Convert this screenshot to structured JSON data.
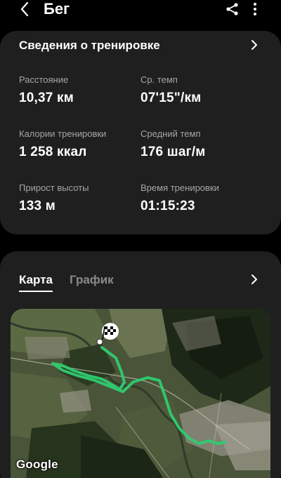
{
  "header": {
    "title": "Бег",
    "icons": {
      "back": "chevron-left-icon",
      "share": "share-icon",
      "more": "more-vertical-icon"
    }
  },
  "details": {
    "title": "Сведения о тренировке",
    "metrics": {
      "distance": {
        "label": "Расстояние",
        "value": "10,37",
        "unit": "км"
      },
      "pace": {
        "label": "Ср. темп",
        "value": "07'15\"/км",
        "unit": ""
      },
      "calories": {
        "label": "Калории тренировки",
        "value": "1 258",
        "unit": "ккал"
      },
      "cadence": {
        "label": "Средний темп",
        "value": "176",
        "unit": "шаг/м"
      },
      "elevation": {
        "label": "Прирост высоты",
        "value": "133",
        "unit": "м"
      },
      "time": {
        "label": "Время тренировки",
        "value": "01:15:23",
        "unit": ""
      }
    }
  },
  "map_section": {
    "tabs": [
      {
        "label": "Карта",
        "active": true
      },
      {
        "label": "График",
        "active": false
      }
    ],
    "attribution": "Google",
    "route_color": "#2ecc71"
  },
  "colors": {
    "background": "#000000",
    "card": "#1f1f1f",
    "label": "#a6a6a6",
    "text": "#ffffff"
  }
}
